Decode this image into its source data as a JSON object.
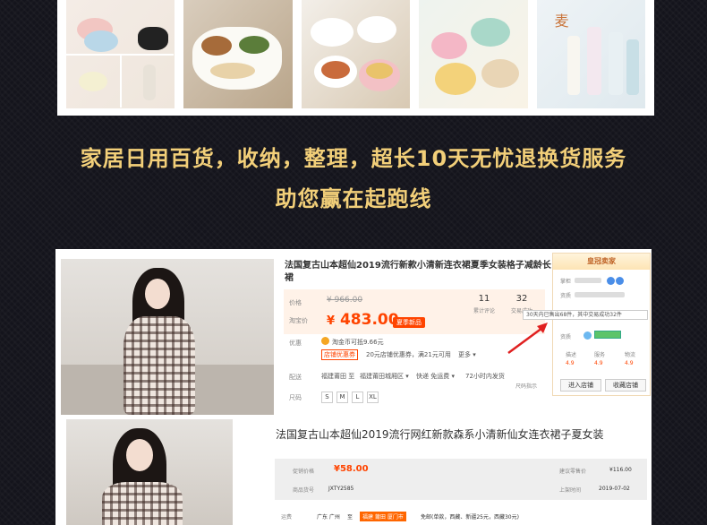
{
  "headline": {
    "line1": "家居日用百货，收纳，整理，超长10天无忧退换货服务",
    "line2": "助您赢在起跑线"
  },
  "colors": {
    "background": "#14141c",
    "headline": "#f2cf79",
    "price": "#ff4400"
  },
  "product1": {
    "title": "法国复古山本超仙2019流行新款小清新连衣裙夏季女装格子减龄长裙",
    "price_label": "价格",
    "original_price": "¥ 966.00",
    "promo_label": "淘宝价",
    "price": "483.00",
    "currency": "¥",
    "promo_badge": "夏季新品",
    "stats": [
      {
        "num": "11",
        "label": "累计评论"
      },
      {
        "num": "32",
        "label": "交易成功"
      }
    ],
    "benefit_label": "优惠",
    "coin_text": "淘金币可抵9.66元",
    "coupon_badge": "店铺优惠券",
    "coupon_text": "20元店铺优惠券，满21元可用",
    "more": "更多",
    "ship_label": "配送",
    "ship_from": "福建莆田 至",
    "ship_to": "福建莆田城厢区",
    "express": "快递 免运费",
    "ship_time": "72小时内发货",
    "size_label": "尺码",
    "sizes": [
      "S",
      "M",
      "L",
      "XL"
    ],
    "size_hint": "尺码指示",
    "shop": {
      "header": "皇冠卖家",
      "lbl1": "掌柜",
      "lbl2": "资质",
      "lbl3": "资质",
      "tooltip": "30天内已售出68件，其中交易成功32件",
      "ratings": [
        {
          "label": "描述",
          "value": "4.9"
        },
        {
          "label": "服务",
          "value": "4.9"
        },
        {
          "label": "物流",
          "value": "4.9"
        }
      ],
      "enter_button": "进入店铺",
      "fav_button": "收藏店铺"
    }
  },
  "product2": {
    "title": "法国复古山本超仙2019流行网红新款森系小清新仙女连衣裙子夏女装",
    "price_label": "促销价格",
    "price": "¥58.00",
    "code_label": "商品货号",
    "code": "JXTY2585",
    "ref_price_label": "建议零售价",
    "ref_price": "¥116.00",
    "date_label": "上架时间",
    "date": "2019-07-02",
    "ship_label": "运费",
    "ship_from": "广东 广州",
    "ship_to_label": "至",
    "ship_to": "福建 莆田 厦门市",
    "ship_note": "免邮(单款，西藏、新疆25元，西藏30元)"
  }
}
